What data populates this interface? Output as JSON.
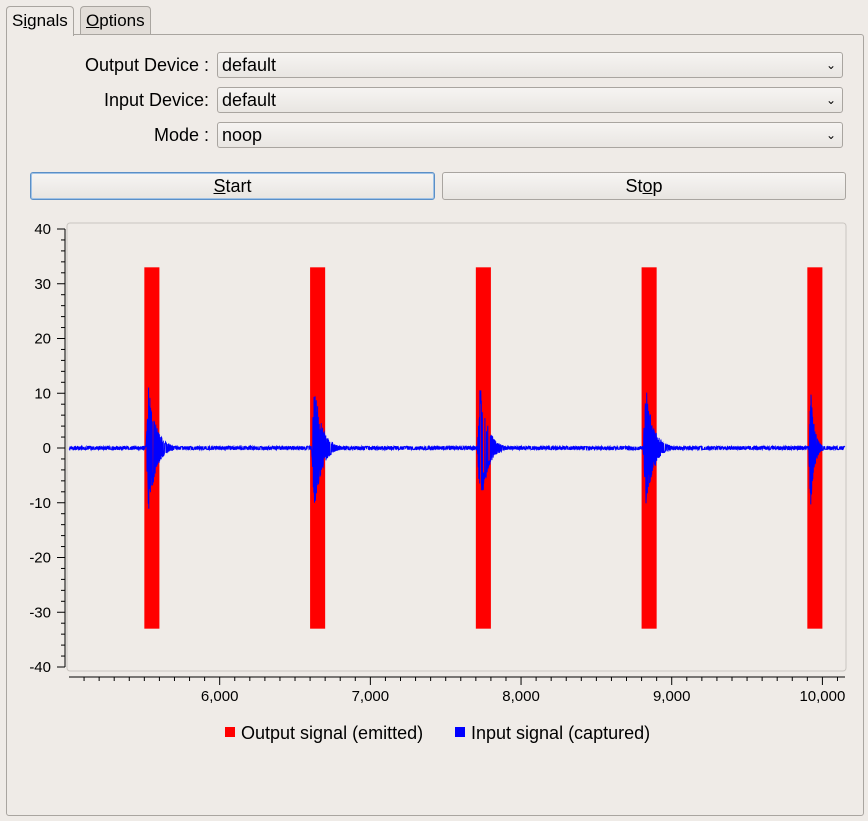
{
  "tabs": [
    {
      "label_pre": "S",
      "label_ul": "i",
      "label_post": "gnals"
    },
    {
      "label_pre": "",
      "label_ul": "O",
      "label_post": "ptions"
    }
  ],
  "form": {
    "output_label": "Output Device :",
    "output_value": "default",
    "input_label": "Input Device:",
    "input_value": "default",
    "mode_label": "Mode :",
    "mode_value": "noop"
  },
  "buttons": {
    "start_ul": "S",
    "start_rest": "tart",
    "stop_pre": "St",
    "stop_ul": "o",
    "stop_post": "p"
  },
  "colors": {
    "output": "#ff0000",
    "input": "#0000ff"
  },
  "chart_data": {
    "type": "line",
    "xlim": [
      5000,
      10150
    ],
    "ylim": [
      -40,
      40
    ],
    "yticks": [
      40,
      30,
      20,
      10,
      0,
      -10,
      -20,
      -30,
      -40
    ],
    "xticks": [
      6000,
      7000,
      8000,
      9000,
      10000
    ],
    "xtick_labels": [
      "6,000",
      "7,000",
      "8,000",
      "9,000",
      "10,000"
    ],
    "series": [
      {
        "name": "Output signal (emitted)",
        "color": "#ff0000",
        "bursts": [
          {
            "start": 5500,
            "end": 5600,
            "amplitude": 33
          },
          {
            "start": 6600,
            "end": 6700,
            "amplitude": 33
          },
          {
            "start": 7700,
            "end": 7800,
            "amplitude": 33
          },
          {
            "start": 8800,
            "end": 8900,
            "amplitude": 33
          },
          {
            "start": 9900,
            "end": 10000,
            "amplitude": 33
          }
        ]
      },
      {
        "name": "Input signal (captured)",
        "color": "#0000ff",
        "bursts": [
          {
            "start": 5510,
            "end": 5700,
            "peak": 12
          },
          {
            "start": 6610,
            "end": 6800,
            "peak": 12
          },
          {
            "start": 7710,
            "end": 7900,
            "peak": 12
          },
          {
            "start": 8810,
            "end": 9000,
            "peak": 12
          },
          {
            "start": 9910,
            "end": 10010,
            "peak": 12
          }
        ]
      }
    ]
  }
}
